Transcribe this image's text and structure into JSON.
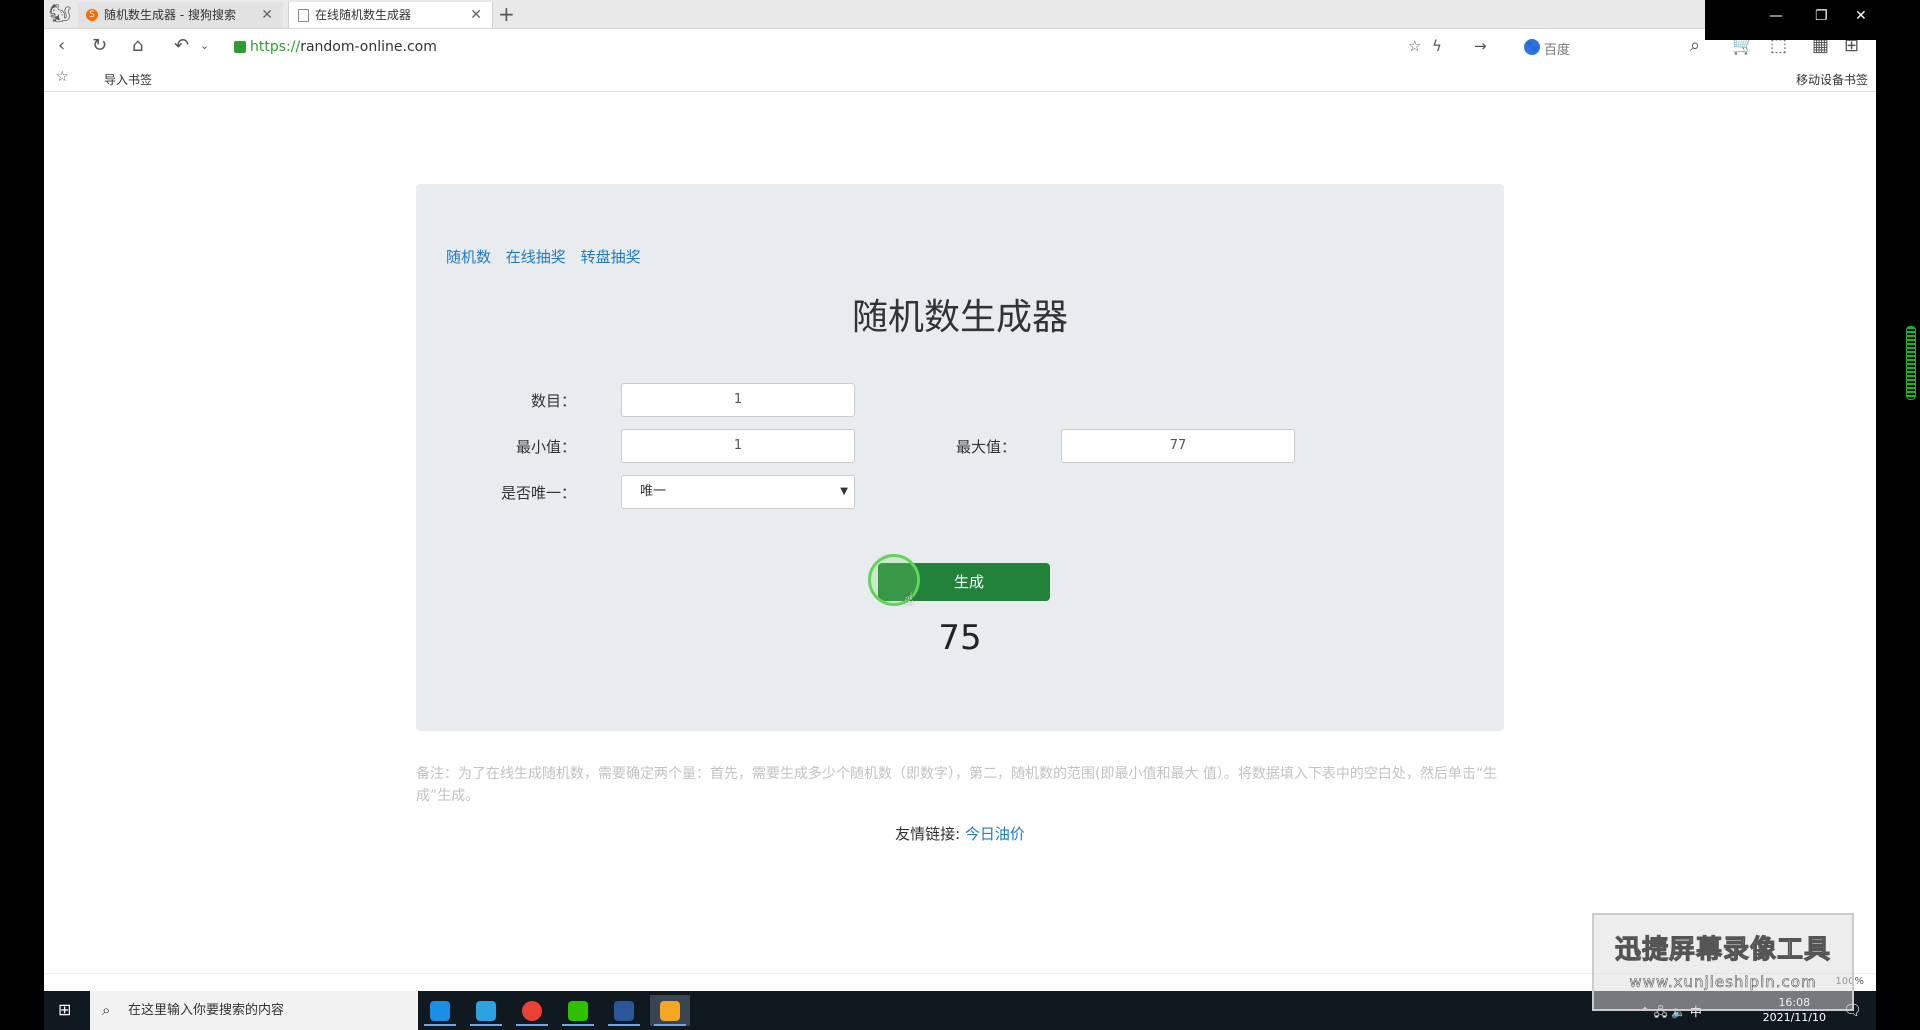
{
  "browser": {
    "tabs": [
      {
        "label": "随机数生成器 - 搜狗搜索",
        "active": false
      },
      {
        "label": "在线随机数生成器",
        "active": true
      }
    ],
    "new_tab": "+",
    "url": "https://random-online.com",
    "url_scheme": "https://",
    "url_host": "random-online.com",
    "search_engine": "百度",
    "bookmark_import": "导入书签",
    "bookmark_mobile": "移动设备书签",
    "zoom": "100%"
  },
  "page": {
    "nav_links": [
      "随机数",
      "在线抽奖",
      "转盘抽奖"
    ],
    "title": "随机数生成器",
    "form": {
      "count_label": "数目：",
      "count_value": "1",
      "min_label": "最小值：",
      "min_value": "1",
      "max_label": "最大值：",
      "max_value": "77",
      "unique_label": "是否唯一：",
      "unique_value": "唯一"
    },
    "generate_label": "生成",
    "result": "75",
    "note": "备注：为了在线生成随机数，需要确定两个量：首先，需要生成多少个随机数（即数字），第二，随机数的范围(即最小值和最大 值）。将数据填入下表中的空白处，然后单击“生成”生成。",
    "friend_label": "友情链接:",
    "friend_link": "今日油价"
  },
  "taskbar": {
    "search_placeholder": "在这里输入你要搜索的内容",
    "time": "16:08",
    "date": "2021/11/10",
    "ime": "中"
  },
  "watermark": {
    "title": "迅捷屏幕录像工具",
    "url": "www.xunjieshipin.com"
  },
  "colors": {
    "accent_green": "#23823a",
    "link_blue": "#1e7bc8",
    "panel_bg": "#e9ecef"
  }
}
